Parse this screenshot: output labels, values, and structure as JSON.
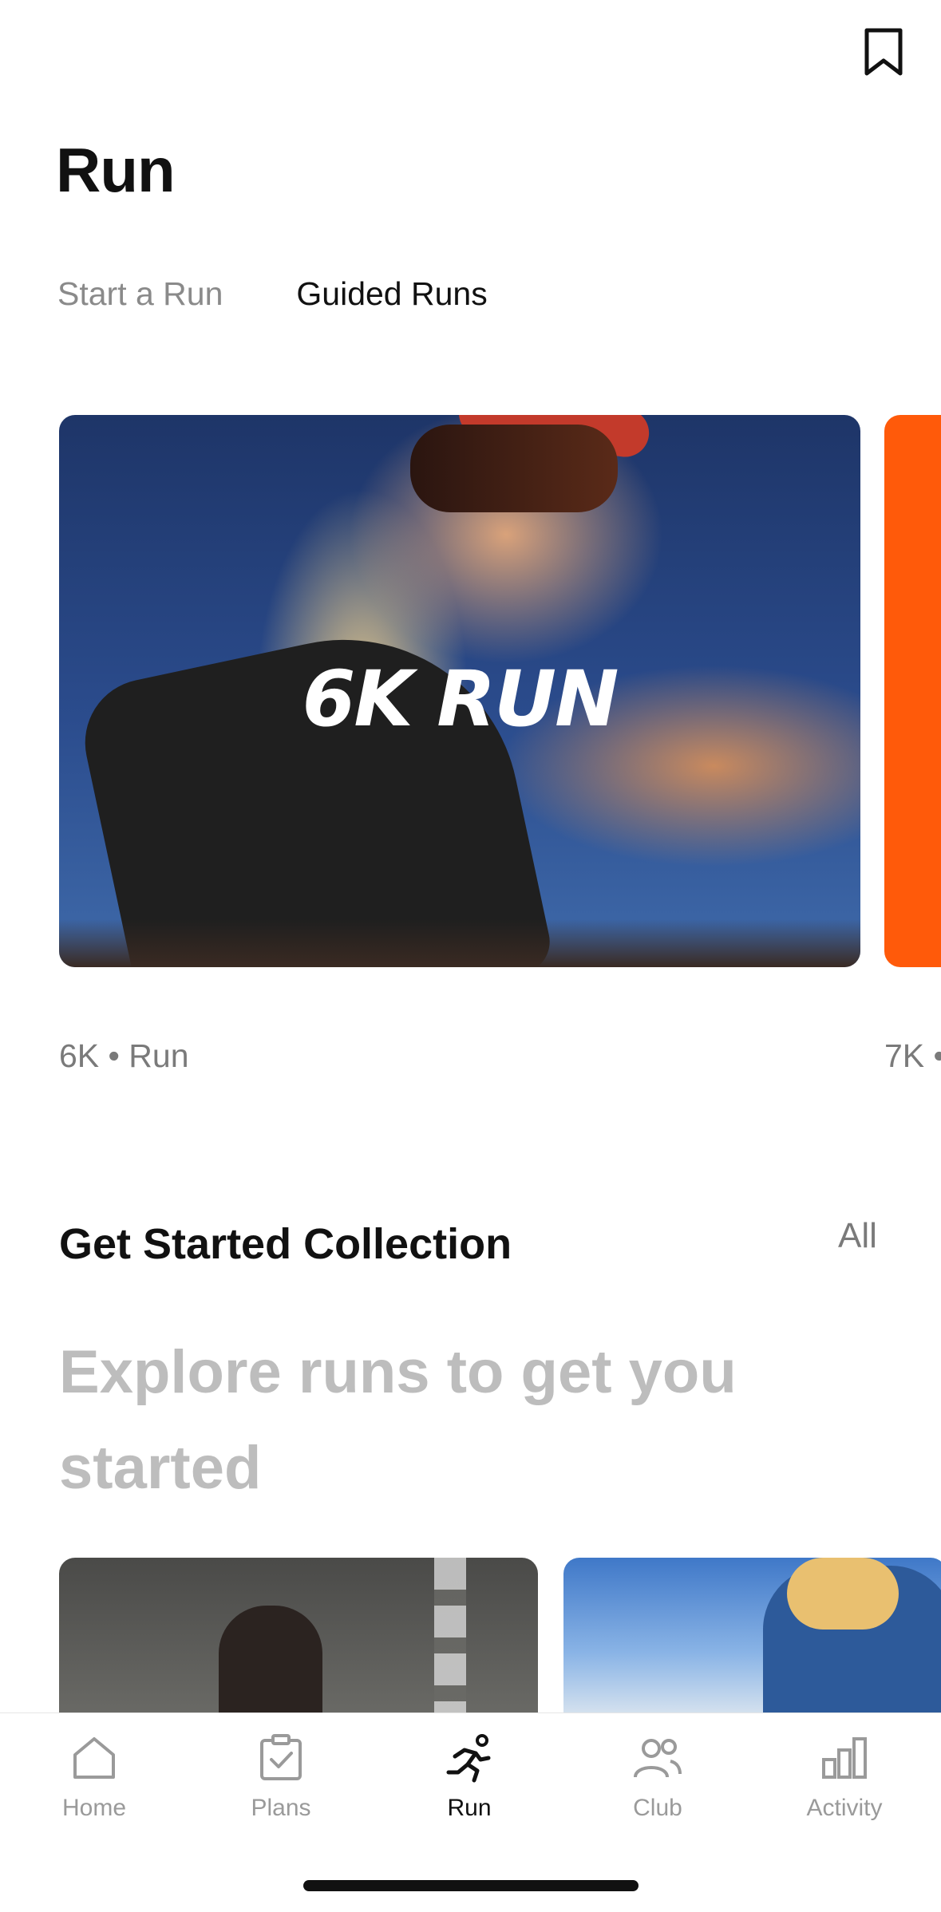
{
  "header": {
    "title": "Run"
  },
  "tabs": [
    {
      "label": "Start a Run",
      "active": false
    },
    {
      "label": "Guided Runs",
      "active": true
    }
  ],
  "featured": {
    "cards": [
      {
        "title": "6K RUN",
        "caption": "6K • Run"
      },
      {
        "title": "",
        "caption": "7K •"
      }
    ]
  },
  "collection": {
    "title": "Get Started Collection",
    "all_label": "All",
    "subtitle": "Explore runs to get you started"
  },
  "nav": {
    "items": [
      {
        "label": "Home",
        "icon": "home-icon",
        "active": false
      },
      {
        "label": "Plans",
        "icon": "plans-icon",
        "active": false
      },
      {
        "label": "Run",
        "icon": "run-icon",
        "active": true
      },
      {
        "label": "Club",
        "icon": "club-icon",
        "active": false
      },
      {
        "label": "Activity",
        "icon": "activity-icon",
        "active": false
      }
    ]
  },
  "colors": {
    "accent": "#ff5a0a",
    "text": "#111111",
    "muted": "#8a8a8a"
  }
}
